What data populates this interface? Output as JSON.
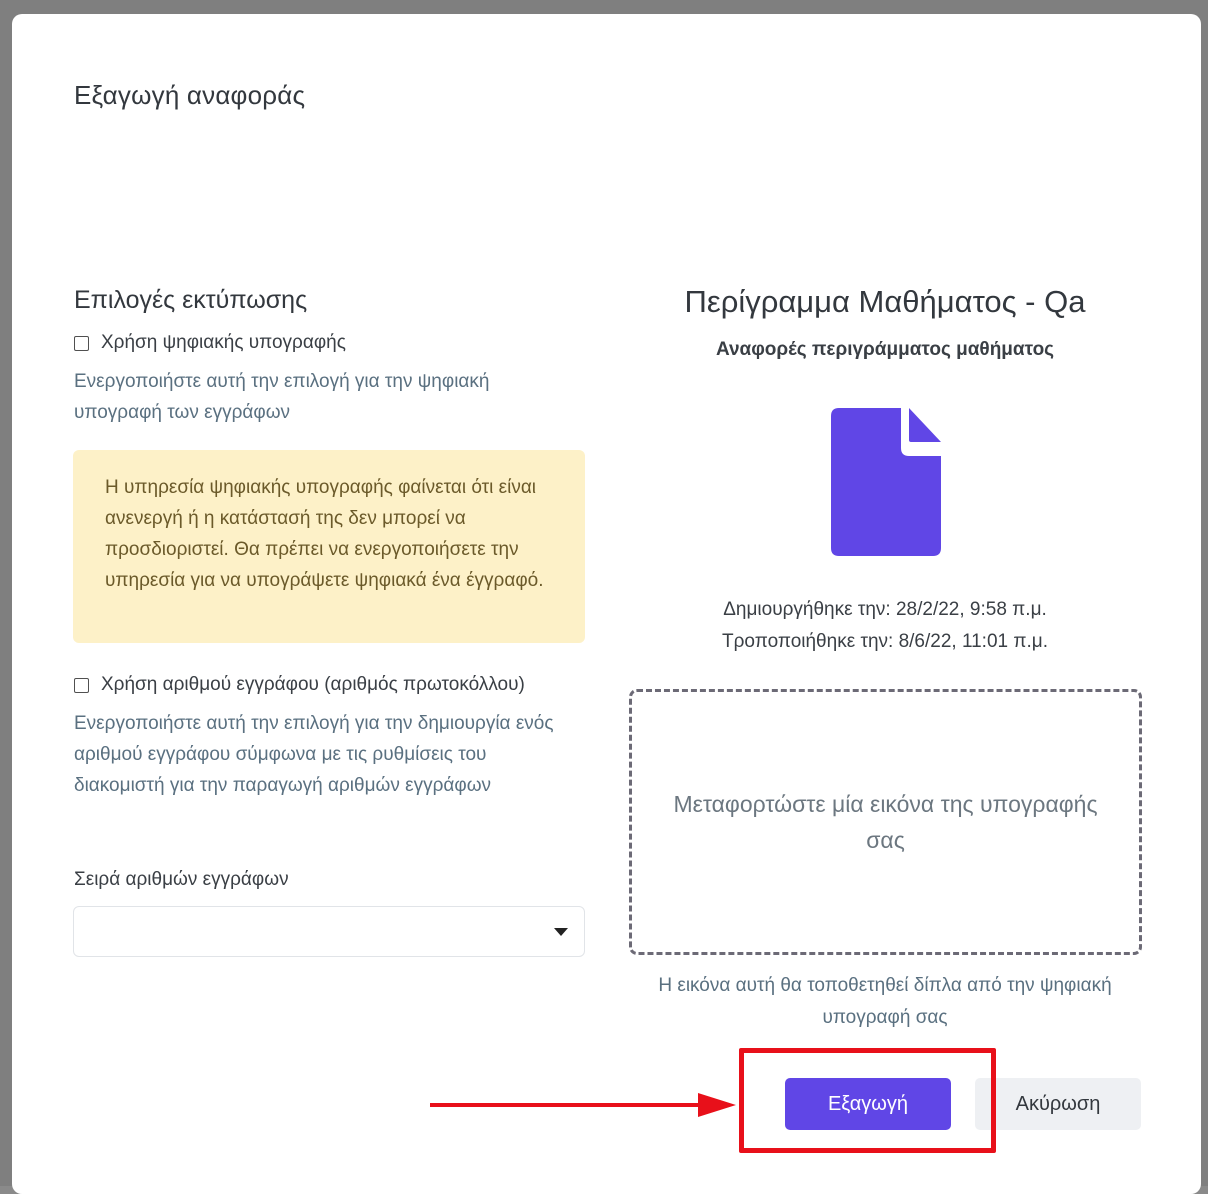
{
  "modal": {
    "title": "Εξαγωγή αναφοράς"
  },
  "print_options": {
    "title": "Επιλογές εκτύπωσης",
    "digital_signature": {
      "label": "Χρήση ψηφιακής υπογραφής",
      "checked": false,
      "help": "Ενεργοποιήστε αυτή την επιλογή για την ψηφιακή υπογραφή των εγγράφων"
    },
    "warning": "Η υπηρεσία ψηφιακής υπογραφής φαίνεται ότι είναι ανενεργή ή η κατάστασή της δεν μπορεί να προσδιοριστεί. Θα πρέπει να ενεργοποιήσετε την υπηρεσία για να υπογράψετε ψηφιακά ένα έγγραφό.",
    "document_number": {
      "label": "Χρήση αριθμού εγγράφου (αριθμός πρωτοκόλλου)",
      "checked": false,
      "help": "Ενεργοποιήστε αυτή την επιλογή για την δημιουργία ενός αριθμού εγγράφου σύμφωνα με τις ρυθμίσεις του διακομιστή για την παραγωγή αριθμών εγγράφων"
    },
    "series": {
      "label": "Σειρά αριθμών εγγράφων",
      "value": ""
    }
  },
  "report": {
    "title": "Περίγραμμα Μαθήματος - Qa",
    "subtitle": "Αναφορές περιγράμματος μαθήματος",
    "icon": "document-icon",
    "created": "Δημιουργήθηκε την: 28/2/22, 9:58 π.μ.",
    "modified": "Τροποποιήθηκε την: 8/6/22, 11:01 π.μ.",
    "dropzone_text": "Μεταφορτώστε μία εικόνα της υπογραφής σας",
    "dropzone_hint": "Η εικόνα αυτή θα τοποθετηθεί δίπλα από την ψηφιακή υπογραφή σας"
  },
  "actions": {
    "export_label": "Εξαγωγή",
    "cancel_label": "Ακύρωση"
  },
  "colors": {
    "primary": "#6046e6",
    "warning_bg": "#fdf1c8",
    "annotation": "#e8101a"
  }
}
